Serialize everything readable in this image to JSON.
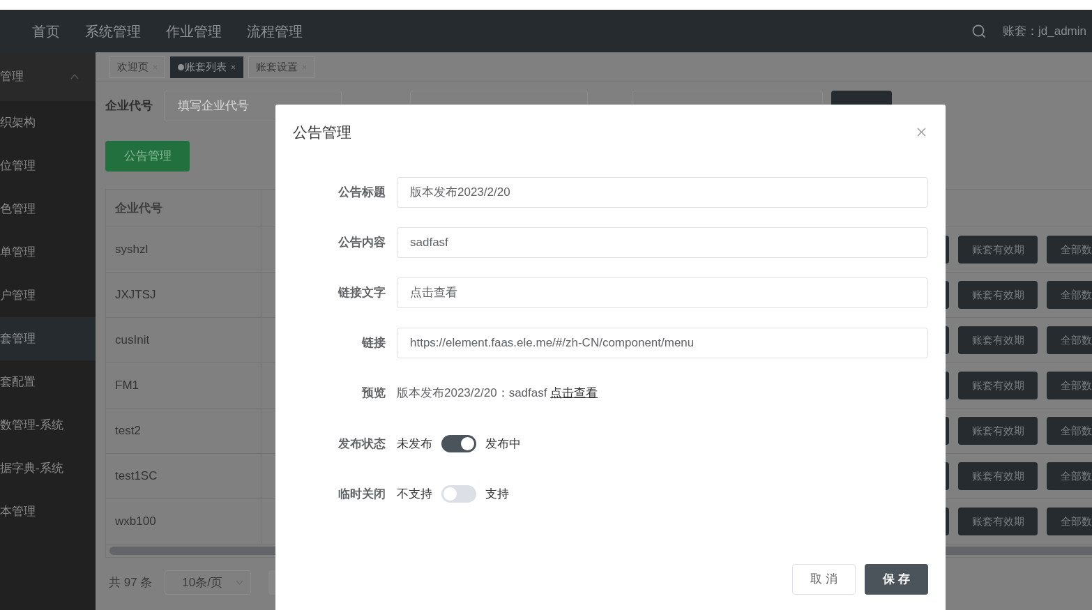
{
  "top_nav": {
    "items": [
      {
        "label": "首页",
        "selected": false
      },
      {
        "label": "系统管理",
        "selected": false
      },
      {
        "label": "作业管理",
        "selected": false
      },
      {
        "label": "流程管理",
        "selected": false
      }
    ],
    "account": "账套：jd_admin"
  },
  "sidebar": {
    "group": {
      "label": "管理",
      "expanded": true
    },
    "items": [
      {
        "label": "织架构",
        "selected": false
      },
      {
        "label": "位管理",
        "selected": false
      },
      {
        "label": "色管理",
        "selected": false
      },
      {
        "label": "单管理",
        "selected": false
      },
      {
        "label": "户管理",
        "selected": false
      },
      {
        "label": "套管理",
        "selected": true
      },
      {
        "label": "套配置",
        "selected": false
      },
      {
        "label": "数管理-系统",
        "selected": false
      },
      {
        "label": "据字典-系统",
        "selected": false
      },
      {
        "label": "本管理",
        "selected": false
      }
    ]
  },
  "tabs": [
    {
      "label": "欢迎页",
      "selected": false
    },
    {
      "label": "账套列表",
      "selected": true
    },
    {
      "label": "账套设置",
      "selected": false
    }
  ],
  "filter": {
    "label": "企业代号",
    "placeholder": "填写企业代号"
  },
  "announce_button": "公告管理",
  "table": {
    "columns": [
      "企业代号"
    ],
    "rows": [
      {
        "code": "syshzl",
        "actions": [
          "账套有效期",
          "全部数"
        ]
      },
      {
        "code": "JXJTSJ",
        "actions": [
          "账套有效期",
          "全部数"
        ]
      },
      {
        "code": "cusInit",
        "actions": [
          "账套有效期",
          "全部数"
        ]
      },
      {
        "code": "FM1",
        "actions": [
          "账套有效期",
          "全部数"
        ]
      },
      {
        "code": "test2",
        "actions": [
          "账套有效期",
          "全部数"
        ]
      },
      {
        "code": "test1SC",
        "actions": [
          "账套有效期",
          "全部数"
        ]
      },
      {
        "code": "wxb100",
        "actions": [
          "账套有效期",
          "全部数"
        ]
      }
    ]
  },
  "pagination": {
    "total": "共 97 条",
    "page_size": "10条/页"
  },
  "dialog": {
    "title": "公告管理",
    "fields": [
      {
        "label": "公告标题",
        "value": "版本发布2023/2/20"
      },
      {
        "label": "公告内容",
        "value": "sadfasf"
      },
      {
        "label": "链接文字",
        "value": "点击查看"
      },
      {
        "label": "链接",
        "value": "https://element.faas.ele.me/#/zh-CN/component/menu"
      }
    ],
    "preview": {
      "label": "预览",
      "text": "版本发布2023/2/20：sadfasf ",
      "link": "点击查看"
    },
    "switches": [
      {
        "label": "发布状态",
        "off_text": "未发布",
        "on_text": "发布中",
        "on": true
      },
      {
        "label": "临时关闭",
        "off_text": "不支持",
        "on_text": "支持",
        "on": false
      }
    ],
    "cancel": "取 消",
    "save": "保 存"
  }
}
